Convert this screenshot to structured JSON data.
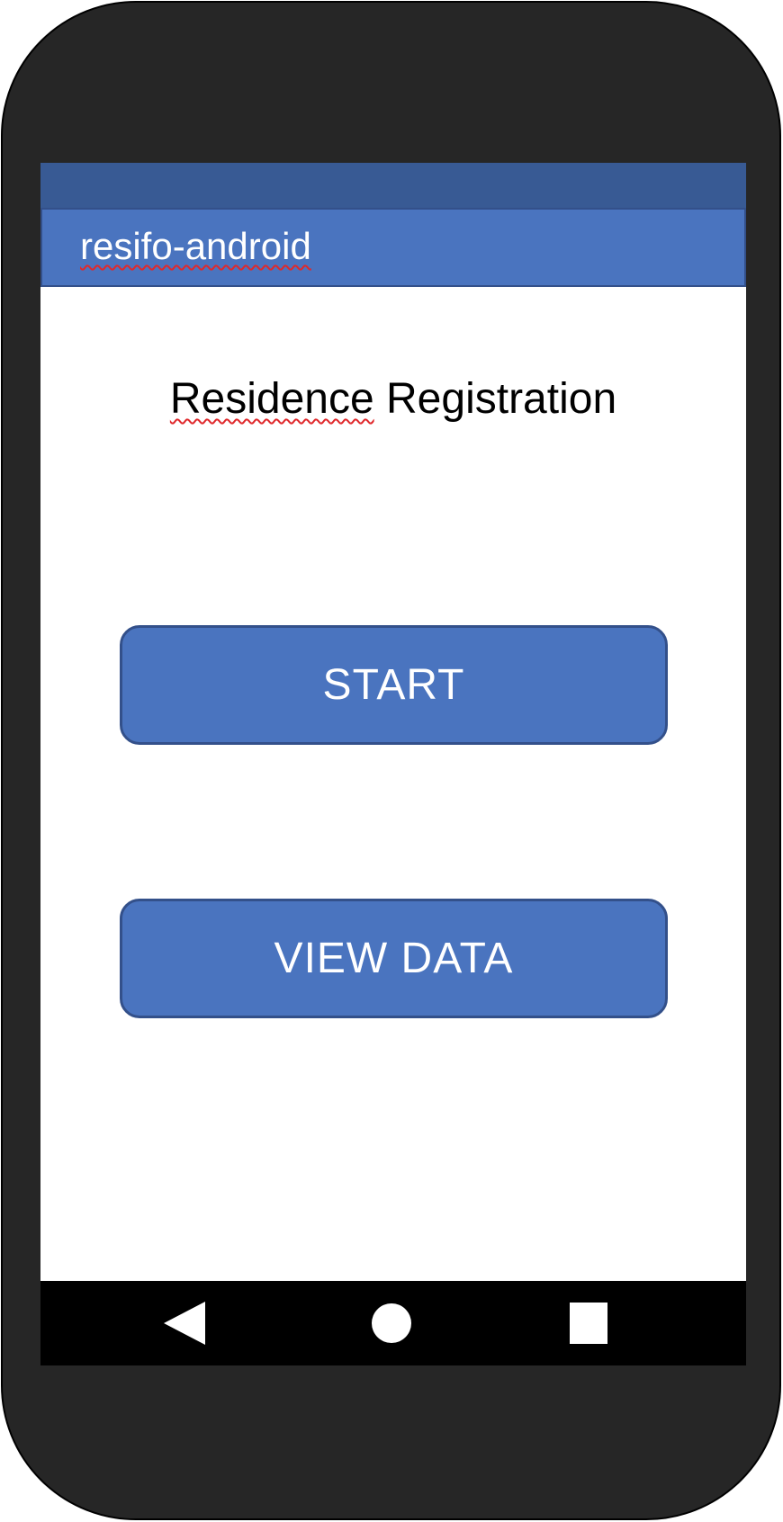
{
  "app_bar": {
    "title": "resifo-android"
  },
  "main": {
    "heading_word_1": "Residence",
    "heading_word_2": "Registration",
    "start_label": "START",
    "view_data_label": "VIEW DATA"
  },
  "nav_bar": {
    "back_icon": "back-triangle-icon",
    "home_icon": "home-circle-icon",
    "recents_icon": "recents-square-icon"
  },
  "colors": {
    "device_body": "#262626",
    "status_bar": "#385a94",
    "primary": "#4a74bf",
    "primary_border": "#33508a",
    "nav_bar": "#000000",
    "spellcheck_underline": "#e0282b"
  }
}
